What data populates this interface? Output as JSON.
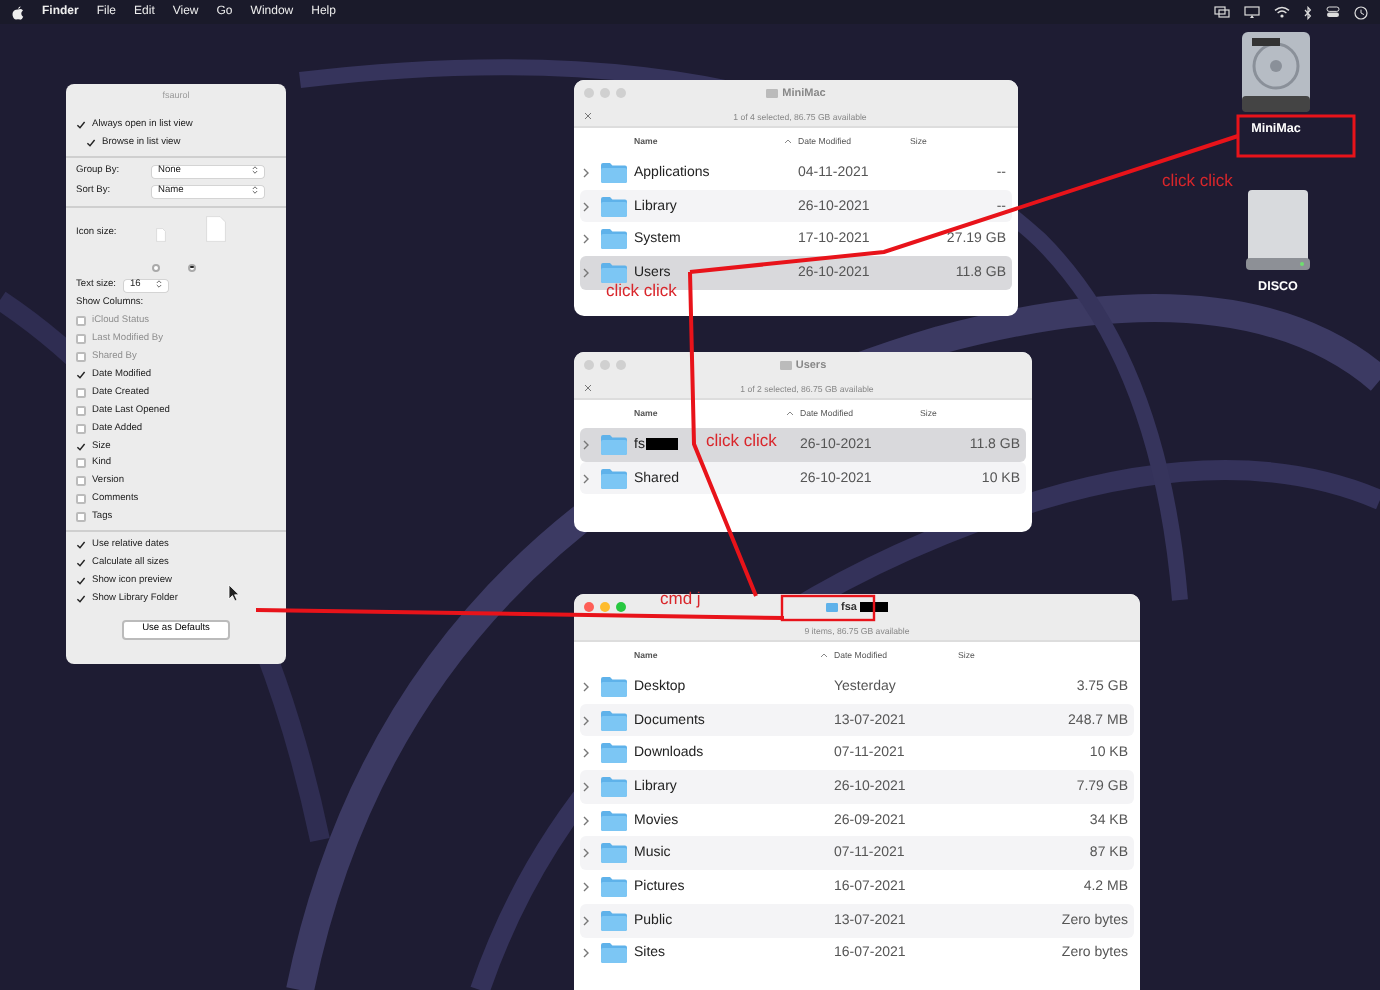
{
  "menu_bar": {
    "app": "Finder",
    "items": [
      "File",
      "Edit",
      "View",
      "Go",
      "Window",
      "Help"
    ]
  },
  "view_options": {
    "title": "fsaurol",
    "view_checks": [
      {
        "label": "Always open in list view",
        "checked": true
      },
      {
        "label": "Browse in list view",
        "checked": true
      }
    ],
    "group_by": {
      "label": "Group By:",
      "value": "None"
    },
    "sort_by": {
      "label": "Sort By:",
      "value": "Name"
    },
    "icon_size": {
      "label": "Icon size:",
      "options": [
        {
          "selected": false
        },
        {
          "selected": true
        }
      ]
    },
    "text_size": {
      "label": "Text size:",
      "value": "16"
    },
    "show_columns": {
      "label": "Show Columns:",
      "items": [
        {
          "label": "iCloud Status",
          "checked": false,
          "disabled": true
        },
        {
          "label": "Last Modified By",
          "checked": false,
          "disabled": true
        },
        {
          "label": "Shared By",
          "checked": false,
          "disabled": true
        },
        {
          "label": "Date Modified",
          "checked": true,
          "disabled": false
        },
        {
          "label": "Date Created",
          "checked": false,
          "disabled": false
        },
        {
          "label": "Date Last Opened",
          "checked": false,
          "disabled": false
        },
        {
          "label": "Date Added",
          "checked": false,
          "disabled": false
        },
        {
          "label": "Size",
          "checked": true,
          "disabled": false
        },
        {
          "label": "Kind",
          "checked": false,
          "disabled": false
        },
        {
          "label": "Version",
          "checked": false,
          "disabled": false
        },
        {
          "label": "Comments",
          "checked": false,
          "disabled": false
        },
        {
          "label": "Tags",
          "checked": false,
          "disabled": false
        }
      ]
    },
    "options": [
      {
        "label": "Use relative dates",
        "checked": true
      },
      {
        "label": "Calculate all sizes",
        "checked": true
      },
      {
        "label": "Show icon preview",
        "checked": true
      },
      {
        "label": "Show Library Folder",
        "checked": true
      }
    ],
    "button": "Use as Defaults"
  },
  "windows": [
    {
      "title": "MiniMac",
      "title_redacted": false,
      "active": false,
      "status": "1 of 4 selected, 86.75 GB available",
      "columns": [
        "Name",
        "Date Modified",
        "Size"
      ],
      "rows": [
        {
          "name": "Applications",
          "redacted": false,
          "date": "04-11-2021",
          "size": "--",
          "selected": false
        },
        {
          "name": "Library",
          "redacted": false,
          "date": "26-10-2021",
          "size": "--",
          "selected": false
        },
        {
          "name": "System",
          "redacted": false,
          "date": "17-10-2021",
          "size": "27.19 GB",
          "selected": false
        },
        {
          "name": "Users",
          "redacted": false,
          "date": "26-10-2021",
          "size": "11.8 GB",
          "selected": true
        }
      ]
    },
    {
      "title": "Users",
      "title_redacted": false,
      "active": false,
      "status": "1 of 2 selected, 86.75 GB available",
      "columns": [
        "Name",
        "Date Modified",
        "Size"
      ],
      "rows": [
        {
          "name": "fs",
          "redacted": true,
          "date": "26-10-2021",
          "size": "11.8 GB",
          "selected": true
        },
        {
          "name": "Shared",
          "redacted": false,
          "date": "26-10-2021",
          "size": "10 KB",
          "selected": false
        }
      ]
    },
    {
      "title": "fsa",
      "title_redacted": true,
      "active": true,
      "status": "9 items, 86.75 GB available",
      "columns": [
        "Name",
        "Date Modified",
        "Size"
      ],
      "rows": [
        {
          "name": "Desktop",
          "redacted": false,
          "date": "Yesterday",
          "size": "3.75 GB",
          "selected": false
        },
        {
          "name": "Documents",
          "redacted": false,
          "date": "13-07-2021",
          "size": "248.7 MB",
          "selected": false
        },
        {
          "name": "Downloads",
          "redacted": false,
          "date": "07-11-2021",
          "size": "10 KB",
          "selected": false
        },
        {
          "name": "Library",
          "redacted": false,
          "date": "26-10-2021",
          "size": "7.79 GB",
          "selected": false
        },
        {
          "name": "Movies",
          "redacted": false,
          "date": "26-09-2021",
          "size": "34 KB",
          "selected": false
        },
        {
          "name": "Music",
          "redacted": false,
          "date": "07-11-2021",
          "size": "87 KB",
          "selected": false
        },
        {
          "name": "Pictures",
          "redacted": false,
          "date": "16-07-2021",
          "size": "4.2 MB",
          "selected": false
        },
        {
          "name": "Public",
          "redacted": false,
          "date": "13-07-2021",
          "size": "Zero bytes",
          "selected": false
        },
        {
          "name": "Sites",
          "redacted": false,
          "date": "16-07-2021",
          "size": "Zero bytes",
          "selected": false
        }
      ]
    }
  ],
  "desktop_icons": [
    {
      "label": "MiniMac",
      "kind": "hard-drive"
    },
    {
      "label": "DISCO",
      "kind": "external-drive"
    }
  ],
  "annotations": [
    "click click",
    "click click",
    "cmd j",
    "click click"
  ]
}
